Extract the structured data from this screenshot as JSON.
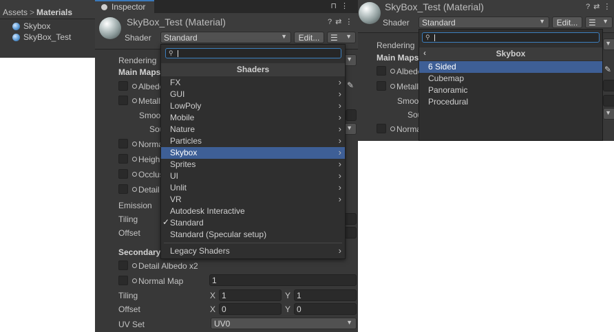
{
  "project": {
    "breadcrumb": {
      "root": "Assets",
      "folder": "Materials"
    },
    "items": [
      "Skybox",
      "SkyBox_Test"
    ]
  },
  "inspector": {
    "tab_label": "Inspector",
    "material_title": "SkyBox_Test (Material)",
    "shader_label": "Shader",
    "shader_value": "Standard",
    "edit_button": "Edit...",
    "properties": {
      "rendering": "Rendering",
      "main_maps": "Main Maps",
      "albedo": "Albedo",
      "metallic": "Metallic",
      "smoothness": "Smoothness",
      "source": "Source",
      "normal": "Normal Map",
      "height": "Height Map",
      "occlusion": "Occlusion",
      "detail": "Detail Mask",
      "emission": "Emission",
      "tiling": "Tiling",
      "offset": "Offset",
      "secondary": "Secondary Maps",
      "detail_albedo": "Detail Albedo x2",
      "normal_map": "Normal Map",
      "normal_value": "1",
      "tiling_x": "1",
      "tiling_y": "1",
      "offset_x": "0",
      "offset_y": "0",
      "x_label": "X",
      "y_label": "Y",
      "uv_set_label": "UV Set",
      "uv_set_value": "UV0"
    }
  },
  "shader_menu": {
    "title": "Shaders",
    "items": [
      "FX",
      "GUI",
      "LowPoly",
      "Mobile",
      "Nature",
      "Particles",
      "Skybox",
      "Sprites",
      "UI",
      "Unlit",
      "VR",
      "Autodesk Interactive",
      "Standard",
      "Standard (Specular setup)",
      "Legacy Shaders"
    ],
    "selected": "Skybox",
    "checked": "Standard"
  },
  "skybox_menu": {
    "title": "Skybox",
    "items": [
      "6 Sided",
      "Cubemap",
      "Panoramic",
      "Procedural"
    ],
    "selected": "6 Sided"
  },
  "inspector2": {
    "material_title": "SkyBox_Test (Material)",
    "shader_label": "Shader",
    "shader_value": "Standard",
    "edit_button": "Edit...",
    "rendering": "Rendering",
    "main_maps": "Main Maps",
    "albedo": "Albedo",
    "metallic": "Metallic",
    "smoothness": "Smoothness",
    "source": "Source",
    "normal": "Normal Map"
  },
  "colors": {
    "accent": "#3e5f96",
    "focus": "#3c7fbe",
    "panel": "#383838"
  }
}
